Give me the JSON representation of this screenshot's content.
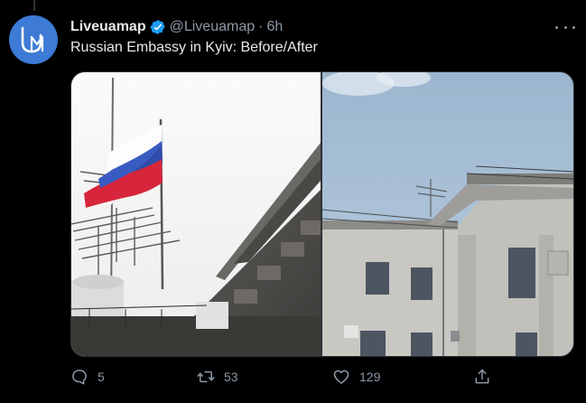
{
  "tweet": {
    "display_name": "Liveuamap",
    "handle": "@Liveuamap",
    "separator": "·",
    "time": "6h",
    "text": "Russian Embassy in Kyiv: Before/After",
    "verified": true,
    "avatar_text": "UM"
  },
  "media": {
    "before_alt": "Russian flag on embassy roof",
    "after_alt": "Embassy roof without flag"
  },
  "actions": {
    "replies": "5",
    "retweets": "53",
    "likes": "129"
  },
  "colors": {
    "background": "#000000",
    "text": "#e7e9ea",
    "secondary": "#8b98a5",
    "verified": "#1d9bf0",
    "avatar": "#3d7bd6"
  }
}
